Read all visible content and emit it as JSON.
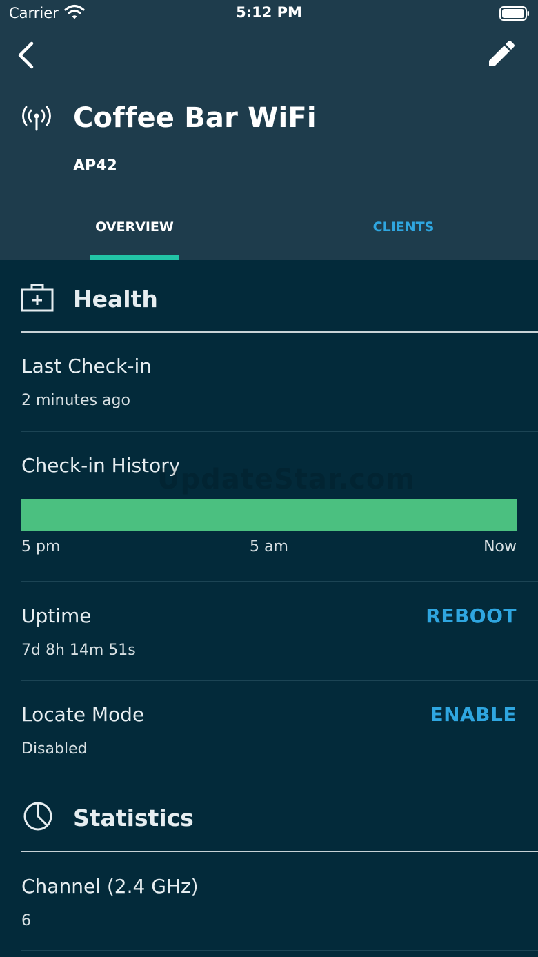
{
  "status_bar": {
    "carrier": "Carrier",
    "time": "5:12 PM"
  },
  "header": {
    "title": "Coffee Bar WiFi",
    "subtitle": "AP42"
  },
  "tabs": [
    {
      "label": "OVERVIEW",
      "active": true
    },
    {
      "label": "CLIENTS",
      "active": false
    }
  ],
  "health": {
    "title": "Health",
    "last_checkin": {
      "label": "Last Check-in",
      "value": "2 minutes ago"
    },
    "checkin_history": {
      "label": "Check-in History",
      "axis": [
        "5 pm",
        "5 am",
        "Now"
      ],
      "status_color": "#4bc080",
      "online_fraction": 1.0
    },
    "uptime": {
      "label": "Uptime",
      "value": "7d 8h 14m 51s",
      "action": "REBOOT"
    },
    "locate_mode": {
      "label": "Locate Mode",
      "value": "Disabled",
      "action": "ENABLE"
    }
  },
  "statistics": {
    "title": "Statistics",
    "channel": {
      "label": "Channel (2.4 GHz)",
      "value": "6"
    }
  },
  "watermark": "UpdateStar.com",
  "icons": {
    "back": "chevron-left-icon",
    "edit": "pencil-icon",
    "access_point": "antenna-icon",
    "health": "first-aid-kit-icon",
    "statistics": "pie-chart-icon"
  },
  "colors": {
    "header_bg": "#1e3c4c",
    "page_bg": "#032a3a",
    "accent": "#2fa6e0",
    "tab_indicator": "#22c4a6",
    "history_ok": "#4bc080"
  }
}
